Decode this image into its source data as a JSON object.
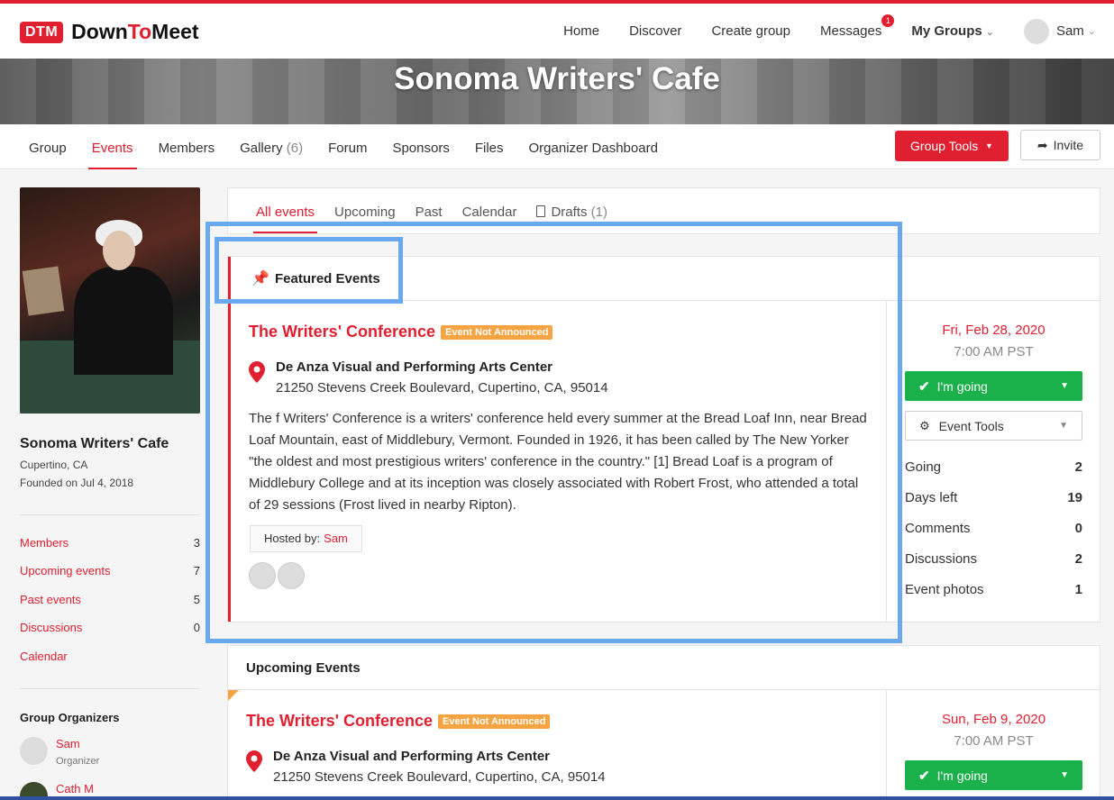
{
  "app": {
    "logo_badge": "DTM",
    "logo_pre": "Down",
    "logo_to": "To",
    "logo_post": "Meet"
  },
  "nav": {
    "home": "Home",
    "discover": "Discover",
    "create_group": "Create group",
    "messages": "Messages",
    "messages_badge": "1",
    "my_groups": "My Groups",
    "user": "Sam"
  },
  "group": {
    "title": "Sonoma Writers' Cafe",
    "location": "Cupertino, CA",
    "founded": "Founded on Jul 4, 2018"
  },
  "group_tabs": [
    {
      "label": "Group"
    },
    {
      "label": "Events"
    },
    {
      "label": "Members"
    },
    {
      "label": "Gallery",
      "count": "(6)"
    },
    {
      "label": "Forum"
    },
    {
      "label": "Sponsors"
    },
    {
      "label": "Files"
    },
    {
      "label": "Organizer Dashboard"
    }
  ],
  "actions": {
    "group_tools": "Group Tools",
    "invite": "Invite"
  },
  "sidebar": {
    "stats": [
      {
        "label": "Members",
        "value": "3"
      },
      {
        "label": "Upcoming events",
        "value": "7"
      },
      {
        "label": "Past events",
        "value": "5"
      },
      {
        "label": "Discussions",
        "value": "0"
      },
      {
        "label": "Calendar",
        "value": ""
      }
    ],
    "organizers_title": "Group Organizers",
    "organizers": [
      {
        "name": "Sam",
        "role": "Organizer"
      },
      {
        "name": "Cath M",
        "role": ""
      }
    ]
  },
  "event_tabs": [
    {
      "label": "All events"
    },
    {
      "label": "Upcoming"
    },
    {
      "label": "Past"
    },
    {
      "label": "Calendar"
    },
    {
      "label": "Drafts",
      "count": "(1)"
    }
  ],
  "featured": {
    "heading": "Featured Events",
    "event": {
      "title": "The Writers' Conference",
      "tag": "Event Not Announced",
      "venue": "De Anza Visual and Performing Arts Center",
      "address": "21250 Stevens Creek Boulevard, Cupertino, CA, 95014",
      "description": "The f Writers' Conference is a writers' conference held every summer at the Bread Loaf Inn, near Bread Loaf Mountain, east of Middlebury, Vermont. Founded in 1926, it has been called by The New Yorker \"the oldest and most prestigious writers' conference in the country.\" [1] Bread Loaf is a program of Middlebury College and at its inception was closely associated with Robert Frost, who attended a total of 29 sessions (Frost lived in nearby Ripton).",
      "hosted_label": "Hosted by:",
      "host": "Sam",
      "date": "Fri, Feb 28, 2020",
      "time": "7:00 AM PST",
      "going_button": "I'm going",
      "tools_button": "Event Tools",
      "stats": [
        {
          "label": "Going",
          "value": "2"
        },
        {
          "label": "Days left",
          "value": "19"
        },
        {
          "label": "Comments",
          "value": "0"
        },
        {
          "label": "Discussions",
          "value": "2"
        },
        {
          "label": "Event photos",
          "value": "1"
        }
      ]
    }
  },
  "upcoming": {
    "heading": "Upcoming Events",
    "event": {
      "title": "The Writers' Conference",
      "tag": "Event Not Announced",
      "venue": "De Anza Visual and Performing Arts Center",
      "address": "21250 Stevens Creek Boulevard, Cupertino, CA, 95014",
      "date": "Sun, Feb 9, 2020",
      "time": "7:00 AM PST",
      "going_button": "I'm going"
    }
  },
  "colors": {
    "brand_red": "#e02030",
    "green": "#1ab04a",
    "tag_orange": "#f6a441",
    "highlight_blue": "#6aa8f0"
  }
}
